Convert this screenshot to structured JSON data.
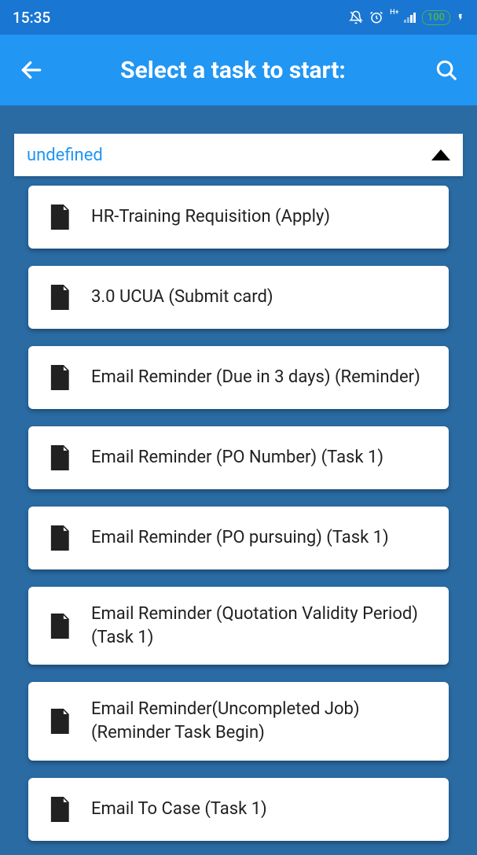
{
  "status": {
    "time": "15:35",
    "battery": "100"
  },
  "header": {
    "title": "Select a task to start:"
  },
  "dropdown": {
    "value": "undefined"
  },
  "tasks": [
    {
      "label": "HR-Training Requisition (Apply)"
    },
    {
      "label": "3.0 UCUA (Submit card)"
    },
    {
      "label": "Email Reminder (Due in 3 days) (Reminder)"
    },
    {
      "label": "Email Reminder (PO Number) (Task 1)"
    },
    {
      "label": "Email Reminder (PO pursuing) (Task 1)"
    },
    {
      "label": "Email Reminder (Quotation Validity Period) (Task 1)"
    },
    {
      "label": "Email Reminder(Uncompleted Job) (Reminder Task Begin)"
    },
    {
      "label": "Email To Case (Task 1)"
    }
  ]
}
